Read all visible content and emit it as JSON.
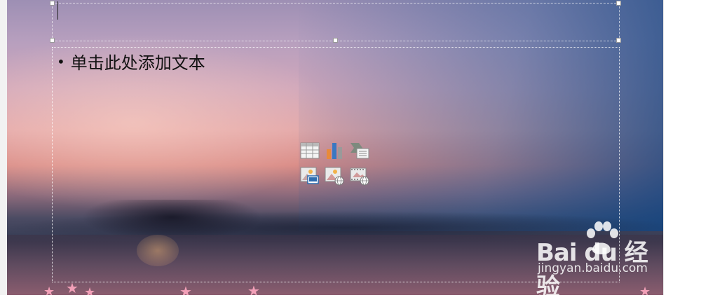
{
  "slide": {
    "bullet_text": "单击此处添加文本",
    "bullet_glyph": "•",
    "content_icons": [
      {
        "name": "insert-table-icon",
        "label": "table"
      },
      {
        "name": "insert-chart-icon",
        "label": "chart"
      },
      {
        "name": "insert-smartart-icon",
        "label": "smartart"
      },
      {
        "name": "insert-picture-icon",
        "label": "picture"
      },
      {
        "name": "insert-online-picture-icon",
        "label": "online-picture"
      },
      {
        "name": "insert-video-icon",
        "label": "video"
      }
    ]
  },
  "watermark": {
    "brand": "Bai du 经验",
    "url": "jingyan.baidu.com"
  },
  "colors": {
    "accent_pink": "#f2a0b8",
    "icon_blue": "#2e6db0",
    "icon_orange": "#e8883a"
  }
}
